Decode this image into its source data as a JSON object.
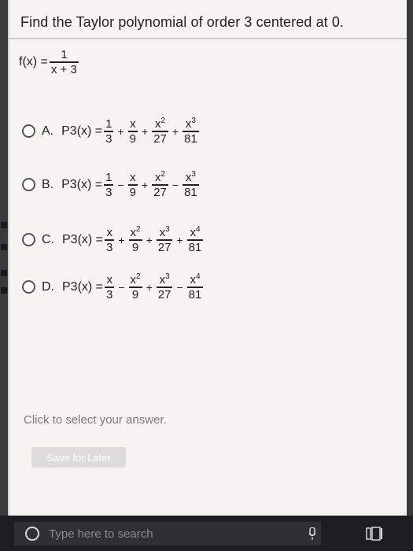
{
  "question": {
    "title": "Find the Taylor polynomial of order 3 centered at 0.",
    "function_label": "f(x) =",
    "function_numerator": "1",
    "function_denominator": "x + 3"
  },
  "options": [
    {
      "letter": "A.",
      "label": "P3(x) =",
      "terms": [
        {
          "sign": "",
          "num": "1",
          "den": "3"
        },
        {
          "sign": "+",
          "num": "x",
          "den": "9"
        },
        {
          "sign": "+",
          "num": "x2",
          "den": "27"
        },
        {
          "sign": "+",
          "num": "x3",
          "den": "81"
        }
      ]
    },
    {
      "letter": "B.",
      "label": "P3(x) =",
      "terms": [
        {
          "sign": "",
          "num": "1",
          "den": "3"
        },
        {
          "sign": "−",
          "num": "x",
          "den": "9"
        },
        {
          "sign": "+",
          "num": "x2",
          "den": "27"
        },
        {
          "sign": "−",
          "num": "x3",
          "den": "81"
        }
      ]
    },
    {
      "letter": "C.",
      "label": "P3(x) =",
      "terms": [
        {
          "sign": "",
          "num": "x",
          "den": "3"
        },
        {
          "sign": "+",
          "num": "x2",
          "den": "9"
        },
        {
          "sign": "+",
          "num": "x3",
          "den": "27"
        },
        {
          "sign": "+",
          "num": "x4",
          "den": "81"
        }
      ]
    },
    {
      "letter": "D.",
      "label": "P3(x) =",
      "terms": [
        {
          "sign": "",
          "num": "x",
          "den": "3"
        },
        {
          "sign": "−",
          "num": "x2",
          "den": "9"
        },
        {
          "sign": "+",
          "num": "x3",
          "den": "27"
        },
        {
          "sign": "−",
          "num": "x4",
          "den": "81"
        }
      ]
    }
  ],
  "hint": "Click to select your answer.",
  "save_button": "Save for Later",
  "taskbar": {
    "search_placeholder": "Type here to search"
  },
  "icons": {
    "search": "cortana-circle-icon",
    "mic": "microphone-icon",
    "task_view": "task-view-icon"
  }
}
